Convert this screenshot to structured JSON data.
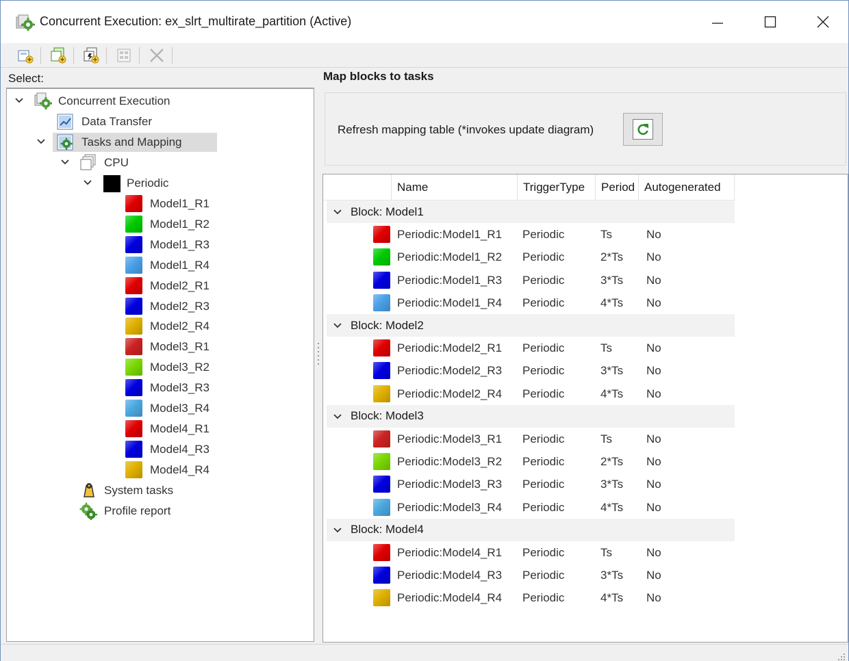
{
  "window": {
    "title": "Concurrent Execution: ex_slrt_multirate_partition (Active)",
    "minimize_label": "",
    "maximize_label": "",
    "close_label": ""
  },
  "toolbar": {
    "buttons": [
      {
        "icon": "add-task-icon"
      },
      {
        "icon": "add-task-group-icon"
      },
      {
        "icon": "add-trigger-icon"
      },
      {
        "icon": "auto-map-icon"
      },
      {
        "icon": "delete-icon"
      }
    ]
  },
  "left": {
    "select_label": "Select:",
    "tree": [
      {
        "label": "Concurrent Execution",
        "icon": "gear-icon"
      },
      {
        "label": "Data Transfer",
        "icon": "data-transfer-icon"
      },
      {
        "label": "Tasks and Mapping",
        "icon": "tasks-mapping-icon"
      },
      {
        "label": "CPU",
        "icon": "cpu-icon"
      },
      {
        "label": "Periodic",
        "icon": "periodic-icon"
      },
      {
        "label": "Model1_R1",
        "color": "#e00000"
      },
      {
        "label": "Model1_R2",
        "color": "#00cc00"
      },
      {
        "label": "Model1_R3",
        "color": "#0000e0"
      },
      {
        "label": "Model1_R4",
        "color": "#4aa0e8"
      },
      {
        "label": "Model2_R1",
        "color": "#e00000"
      },
      {
        "label": "Model2_R3",
        "color": "#0000e0"
      },
      {
        "label": "Model2_R4",
        "color": "#e0b000"
      },
      {
        "label": "Model3_R1",
        "color": "#cc2222"
      },
      {
        "label": "Model3_R2",
        "color": "#7ad800"
      },
      {
        "label": "Model3_R3",
        "color": "#0000e0"
      },
      {
        "label": "Model3_R4",
        "color": "#4aa8e0"
      },
      {
        "label": "Model4_R1",
        "color": "#e00000"
      },
      {
        "label": "Model4_R3",
        "color": "#0000e0"
      },
      {
        "label": "Model4_R4",
        "color": "#e0b000"
      },
      {
        "label": "System tasks",
        "icon": "system-tasks-icon"
      },
      {
        "label": "Profile report",
        "icon": "profile-report-icon"
      }
    ]
  },
  "right": {
    "title": "Map blocks to tasks",
    "refresh_label": "Refresh mapping table (*invokes update diagram)",
    "refresh_icon": "refresh-icon",
    "columns": [
      "Name",
      "TriggerType",
      "Period",
      "Autogenerated"
    ],
    "groups": [
      {
        "label": "Block: Model1",
        "rows": [
          {
            "name": "Periodic:Model1_R1",
            "trigger": "Periodic",
            "period": "Ts",
            "auto": "No",
            "color": "#e00000"
          },
          {
            "name": "Periodic:Model1_R2",
            "trigger": "Periodic",
            "period": "2*Ts",
            "auto": "No",
            "color": "#00cc00"
          },
          {
            "name": "Periodic:Model1_R3",
            "trigger": "Periodic",
            "period": "3*Ts",
            "auto": "No",
            "color": "#0000e0"
          },
          {
            "name": "Periodic:Model1_R4",
            "trigger": "Periodic",
            "period": "4*Ts",
            "auto": "No",
            "color": "#4aa0e8"
          }
        ]
      },
      {
        "label": "Block: Model2",
        "rows": [
          {
            "name": "Periodic:Model2_R1",
            "trigger": "Periodic",
            "period": "Ts",
            "auto": "No",
            "color": "#e00000"
          },
          {
            "name": "Periodic:Model2_R3",
            "trigger": "Periodic",
            "period": "3*Ts",
            "auto": "No",
            "color": "#0000e0"
          },
          {
            "name": "Periodic:Model2_R4",
            "trigger": "Periodic",
            "period": "4*Ts",
            "auto": "No",
            "color": "#e0b000"
          }
        ]
      },
      {
        "label": "Block: Model3",
        "rows": [
          {
            "name": "Periodic:Model3_R1",
            "trigger": "Periodic",
            "period": "Ts",
            "auto": "No",
            "color": "#cc2222"
          },
          {
            "name": "Periodic:Model3_R2",
            "trigger": "Periodic",
            "period": "2*Ts",
            "auto": "No",
            "color": "#7ad800"
          },
          {
            "name": "Periodic:Model3_R3",
            "trigger": "Periodic",
            "period": "3*Ts",
            "auto": "No",
            "color": "#0000e0"
          },
          {
            "name": "Periodic:Model3_R4",
            "trigger": "Periodic",
            "period": "4*Ts",
            "auto": "No",
            "color": "#4aa8e0"
          }
        ]
      },
      {
        "label": "Block: Model4",
        "rows": [
          {
            "name": "Periodic:Model4_R1",
            "trigger": "Periodic",
            "period": "Ts",
            "auto": "No",
            "color": "#e00000"
          },
          {
            "name": "Periodic:Model4_R3",
            "trigger": "Periodic",
            "period": "3*Ts",
            "auto": "No",
            "color": "#0000e0"
          },
          {
            "name": "Periodic:Model4_R4",
            "trigger": "Periodic",
            "period": "4*Ts",
            "auto": "No",
            "color": "#e0b000"
          }
        ]
      }
    ]
  }
}
